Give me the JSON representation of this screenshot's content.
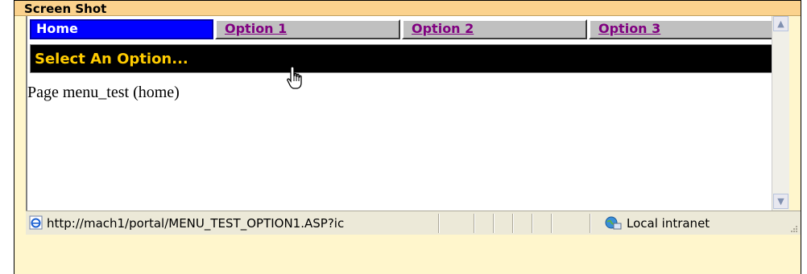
{
  "caption": {
    "title": "Screen Shot"
  },
  "menu": {
    "items": [
      {
        "label": "Home"
      },
      {
        "label": "Option 1"
      },
      {
        "label": "Option 2"
      },
      {
        "label": "Option 3"
      }
    ]
  },
  "banner": {
    "text": "Select An Option..."
  },
  "page": {
    "text": "Page menu_test (home)"
  },
  "status": {
    "url": "http://mach1/portal/MENU_TEST_OPTION1.ASP?ic",
    "zone": "Local intranet"
  },
  "colors": {
    "caption_bg": "#fbd28d",
    "frame_bg": "#fff6cc",
    "home_bg": "#0000ff",
    "option_bg": "#c0c0c0",
    "link_color": "#800080",
    "banner_bg": "#000000",
    "banner_text": "#ffcc00"
  },
  "icons": [
    "hand-cursor-icon",
    "ie-page-icon",
    "local-intranet-icon",
    "scroll-up-icon",
    "scroll-down-icon",
    "resize-grip-icon"
  ]
}
